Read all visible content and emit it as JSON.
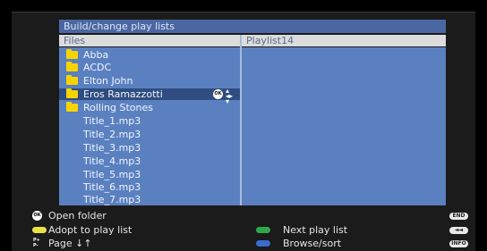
{
  "window": {
    "title": "Build/change play lists"
  },
  "columns": {
    "files": "Files",
    "playlist": "Playlist14"
  },
  "files": [
    {
      "label": "Abba",
      "icon": "folder-icon",
      "selected": false
    },
    {
      "label": "ACDC",
      "icon": "folder-icon",
      "selected": false
    },
    {
      "label": "Elton John",
      "icon": "folder-icon",
      "selected": false
    },
    {
      "label": "Eros Ramazzotti",
      "icon": "folder-icon",
      "selected": true
    },
    {
      "label": "Rolling Stones",
      "icon": "folder-icon",
      "selected": false
    },
    {
      "label": "Title_1.mp3",
      "icon": "",
      "selected": false
    },
    {
      "label": "Title_2.mp3",
      "icon": "",
      "selected": false
    },
    {
      "label": "Title_3.mp3",
      "icon": "",
      "selected": false
    },
    {
      "label": "Title_4.mp3",
      "icon": "",
      "selected": false
    },
    {
      "label": "Title_5.mp3",
      "icon": "",
      "selected": false
    },
    {
      "label": "Title_6.mp3",
      "icon": "",
      "selected": false
    },
    {
      "label": "Title_7.mp3",
      "icon": "",
      "selected": false
    }
  ],
  "selected_row": {
    "ok_badge": "OK",
    "nav_icon": "navigation-arrows-icon"
  },
  "legend": {
    "open_folder": {
      "key": "OK",
      "label": "Open folder"
    },
    "adopt": {
      "key": "yellow-button",
      "label": "Adopt to play list",
      "color": "#e8e24a"
    },
    "page": {
      "key": "P+ P-",
      "label": "Page ↓↑"
    },
    "next_playlist": {
      "key": "green-button",
      "label": "Next play list",
      "color": "#2fa84a"
    },
    "browse": {
      "key": "blue-button",
      "label": "Browse/sort",
      "color": "#3a6bd1"
    },
    "end": {
      "key": "END"
    },
    "rewind": {
      "key": "◄◄"
    },
    "info": {
      "key": "INFO"
    }
  },
  "colors": {
    "pane": "#5a80c0",
    "selected": "#2f4d80",
    "title_bar": "#4a67a3",
    "header": "#dcdcdc"
  }
}
